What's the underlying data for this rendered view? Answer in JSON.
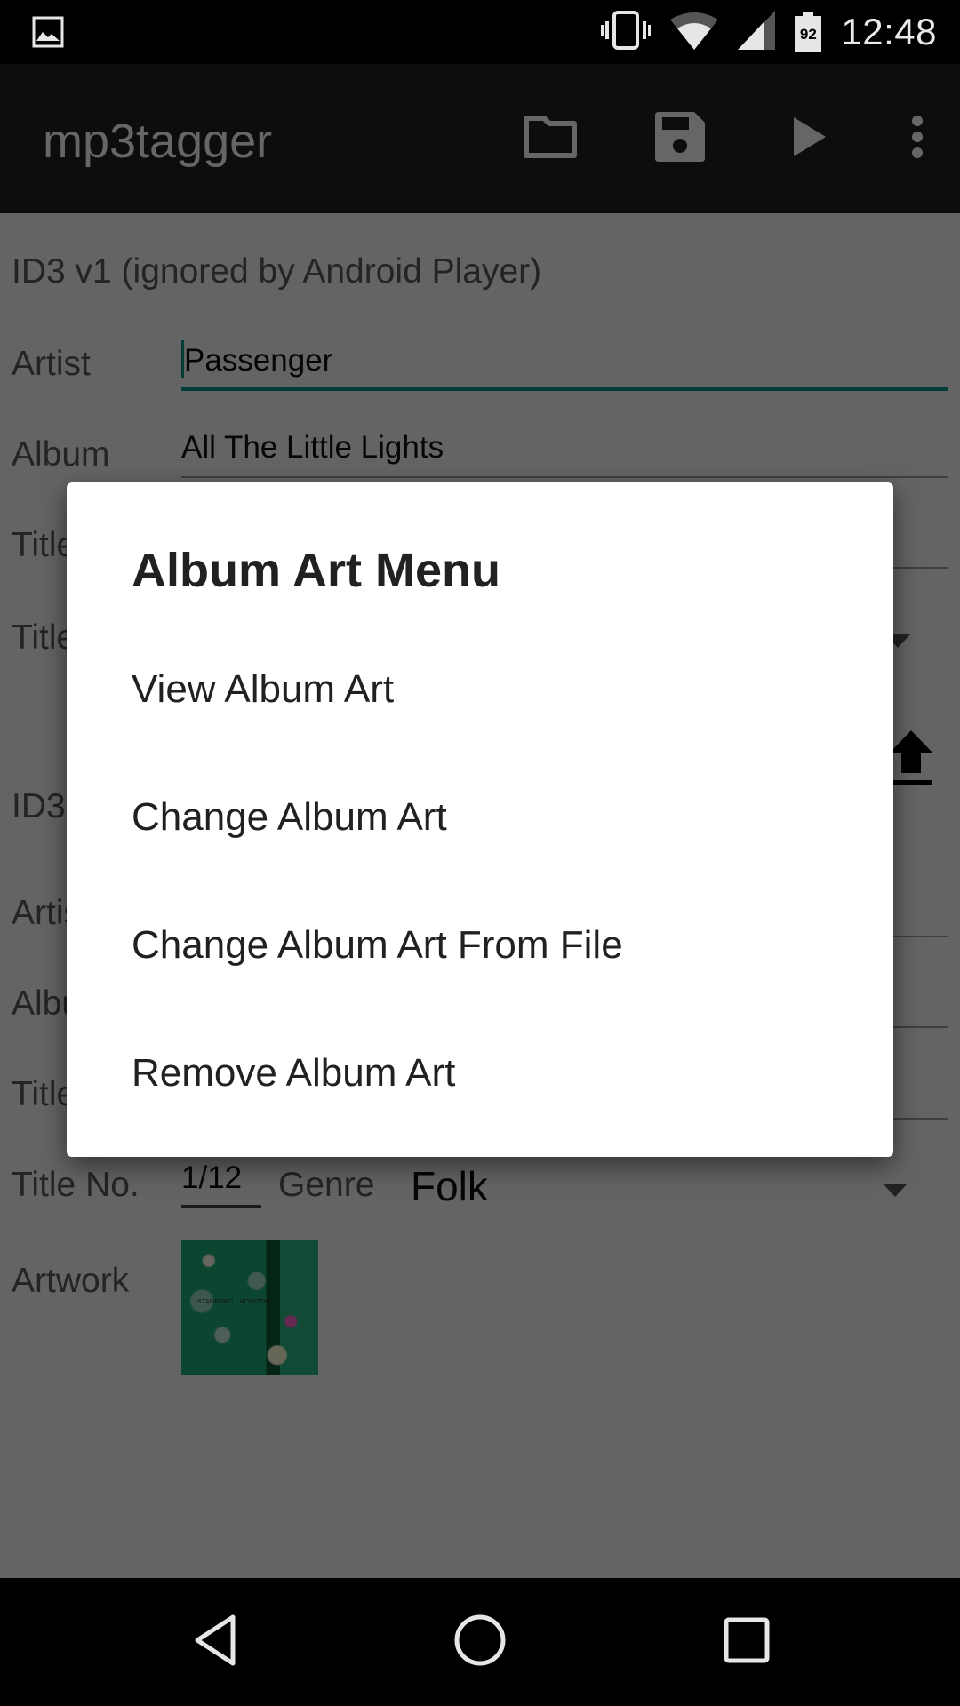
{
  "status_bar": {
    "notification_icon": "image-icon",
    "icons": [
      "vibrate-icon",
      "wifi-icon",
      "cell-signal-icon",
      "battery-icon"
    ],
    "battery_level": "92",
    "time": "12:48"
  },
  "app_bar": {
    "title": "mp3tagger",
    "actions": [
      {
        "name": "open-folder",
        "icon": "folder-icon"
      },
      {
        "name": "save",
        "icon": "save-icon"
      },
      {
        "name": "play",
        "icon": "play-icon"
      },
      {
        "name": "more-options",
        "icon": "more-vert-icon"
      }
    ]
  },
  "form": {
    "id3v1": {
      "section_title": "ID3 v1 (ignored by Android Player)",
      "artist_label": "Artist",
      "artist_value": "Passenger",
      "album_label": "Album",
      "album_value": "All The Little Lights",
      "title_label": "Title",
      "title_value": "",
      "title2_label": "Title",
      "upload_icon": "upload-icon"
    },
    "id3v2": {
      "section_title": "ID3",
      "artist_label": "Artist",
      "album_label": "Album",
      "title_label": "Title",
      "title_no_label": "Title No.",
      "title_no_value": "1/12",
      "genre_label": "Genre",
      "genre_value": "Folk",
      "artwork_label": "Artwork",
      "artwork_caption": "STANFORD - HORIZON"
    }
  },
  "dialog": {
    "title": "Album Art Menu",
    "items": [
      {
        "label": "View Album Art"
      },
      {
        "label": "Change Album Art"
      },
      {
        "label": "Change Album Art From File"
      },
      {
        "label": "Remove Album Art"
      }
    ]
  },
  "nav_bar": {
    "buttons": [
      "back-icon",
      "home-icon",
      "recents-icon"
    ]
  }
}
